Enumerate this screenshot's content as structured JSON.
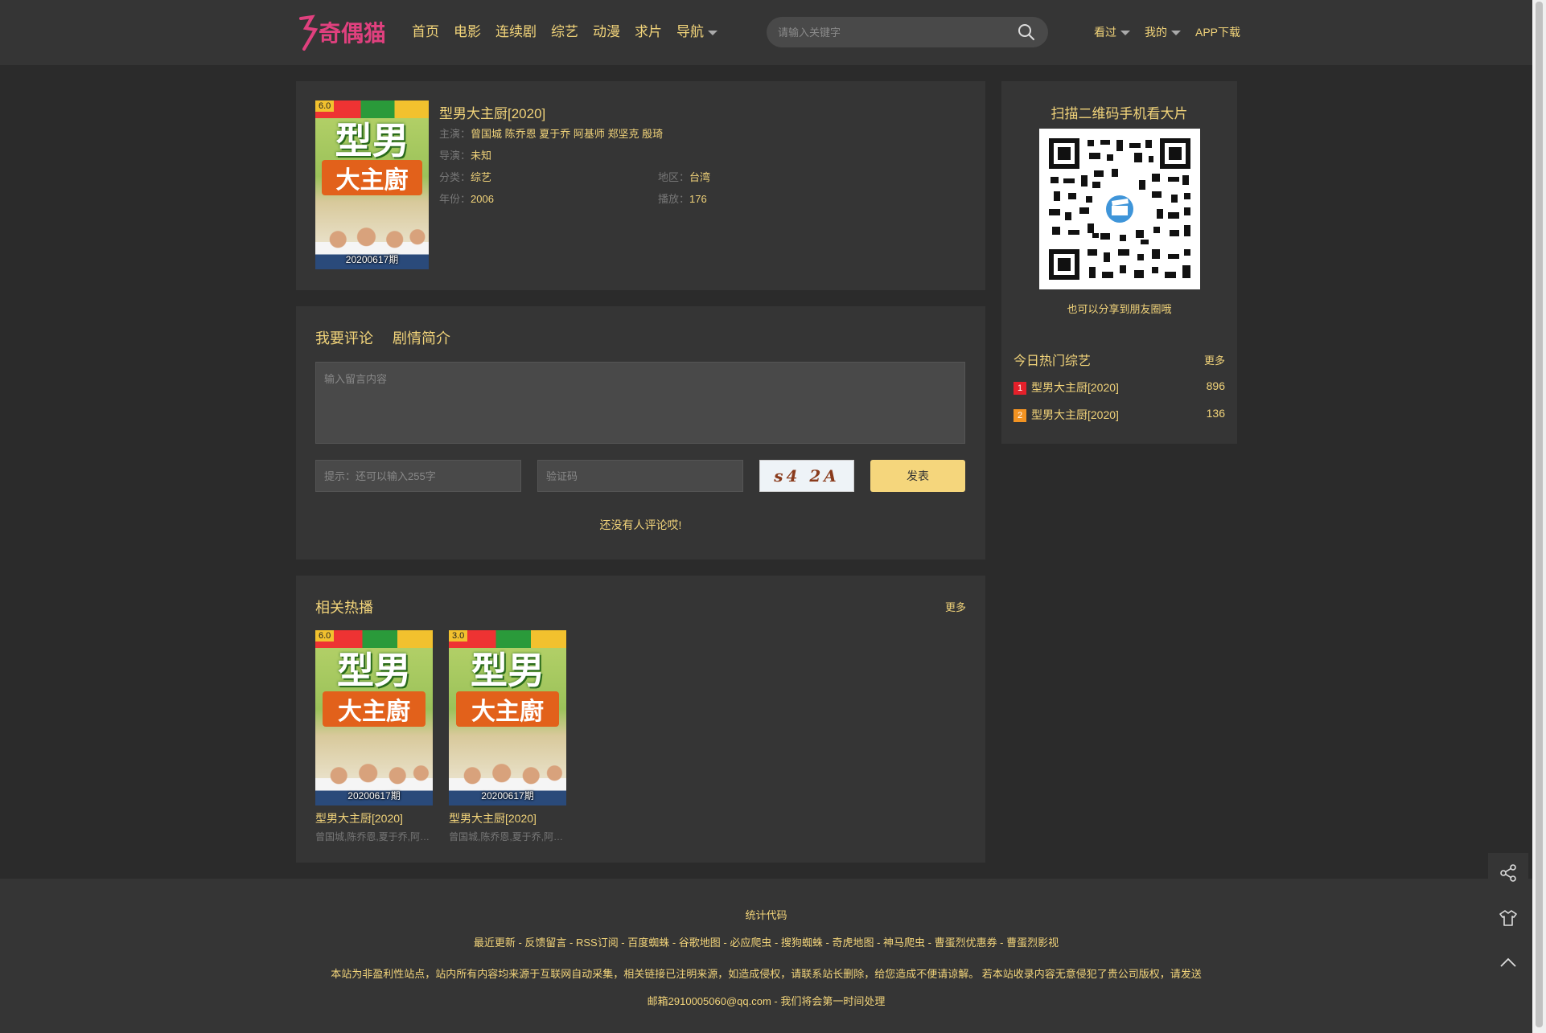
{
  "header": {
    "logo_text": "奇偶猫",
    "nav": [
      "首页",
      "电影",
      "连续剧",
      "综艺",
      "动漫",
      "求片",
      "导航"
    ],
    "search_placeholder": "请输入关键字",
    "user_links": [
      "看过",
      "我的",
      "APP下载"
    ]
  },
  "detail": {
    "title": "型男大主厨[2020]",
    "poster_title_top": "型男",
    "poster_title_bottom": "大主廚",
    "score": "6.0",
    "episode": "20200617期",
    "starring_label": "主演：",
    "starring": "曾国城 陈乔恩 夏于乔 阿基师 郑坚克 殷琦",
    "director_label": "导演：",
    "director": "未知",
    "category_label": "分类：",
    "category": "综艺",
    "region_label": "地区：",
    "region": "台湾",
    "year_label": "年份：",
    "year": "2006",
    "plays_label": "播放：",
    "plays": "176"
  },
  "comment": {
    "tabs": [
      "我要评论",
      "剧情简介"
    ],
    "textarea_placeholder": "输入留言内容",
    "hint_placeholder": "提示：还可以输入255字",
    "captcha_placeholder": "验证码",
    "captcha_text": "s4 2A",
    "submit_label": "发表",
    "empty_text": "还没有人评论哎!"
  },
  "related": {
    "title": "相关热播",
    "more": "更多",
    "items": [
      {
        "name": "型男大主厨[2020]",
        "cast": "曾国城,陈乔恩,夏于乔,阿基师,郑坚克,殷琦",
        "score": "6.0",
        "episode": "20200617期"
      },
      {
        "name": "型男大主厨[2020]",
        "cast": "曾国城,陈乔恩,夏于乔,阿基师,郑坚克,殷琦",
        "score": "3.0",
        "episode": "20200617期"
      }
    ]
  },
  "sidebar": {
    "qr_title": "扫描二维码手机看大片",
    "qr_sub": "也可以分享到朋友圈哦",
    "hot_title": "今日热门综艺",
    "hot_more": "更多",
    "hot_items": [
      {
        "rank": "1",
        "name": "型男大主厨[2020]",
        "count": "896",
        "color": "#e5202a"
      },
      {
        "rank": "2",
        "name": "型男大主厨[2020]",
        "count": "136",
        "color": "#f29322"
      }
    ]
  },
  "footer": {
    "stats": "统计代码",
    "links": "最近更新 - 反馈留言 - RSS订阅 - 百度蜘蛛 - 谷歌地图 - 必应爬虫 - 搜狗蜘蛛 - 奇虎地图 - 神马爬虫 - 曹蛋烈优惠券 - 曹蛋烈影视",
    "disclaimer": "本站为非盈利性站点，站内所有内容均来源于互联网自动采集，相关链接已注明来源，如造成侵权，请联系站长删除，给您造成不便请谅解。 若本站收录内容无意侵犯了贵公司版权，请发送",
    "contact": "邮箱2910005060@qq.com - 我们将会第一时间处理"
  },
  "colors": {
    "accent": "#f2d47a",
    "bg": "#2b2b2b",
    "panel": "#353535",
    "button": "#f5d67c"
  }
}
